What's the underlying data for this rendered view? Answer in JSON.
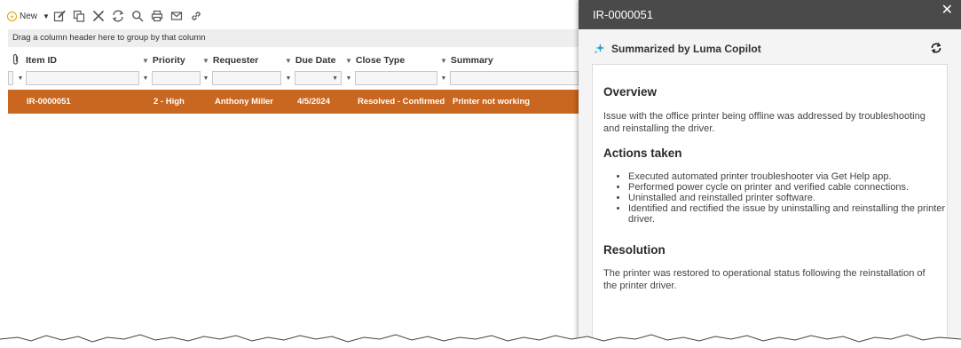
{
  "toolbar": {
    "new_label": "New",
    "icons": [
      "edit-icon",
      "copy-icon",
      "delete-icon",
      "refresh-icon",
      "search-icon",
      "print-icon",
      "email-icon",
      "link-icon"
    ]
  },
  "grid": {
    "group_hint": "Drag a column header here to group by that column",
    "columns": [
      "Item ID",
      "Priority",
      "Requester",
      "Due Date",
      "Close Type",
      "Summary"
    ],
    "rows": [
      {
        "item_id": "IR-0000051",
        "priority": "2 - High",
        "requester": "Anthony Miller",
        "due_date": "4/5/2024",
        "close_type": "Resolved - Confirmed",
        "summary": "Printer not working"
      }
    ],
    "selected_row_color": "#c9661f"
  },
  "panel": {
    "title": "IR-0000051",
    "close_symbol": "✕",
    "copilot_label": "Summarized by Luma Copilot",
    "sections": {
      "overview_heading": "Overview",
      "overview_text": "Issue with the office printer being offline was addressed by troubleshooting and reinstalling the driver.",
      "actions_heading": "Actions taken",
      "actions": [
        "Executed automated printer troubleshooter via Get Help app.",
        "Performed power cycle on printer and verified cable connections.",
        "Uninstalled and reinstalled printer software.",
        "Identified and rectified the issue by uninstalling and reinstalling the printer driver."
      ],
      "resolution_heading": "Resolution",
      "resolution_text": "The printer was restored to operational status following the reinstallation of the printer driver."
    },
    "accent_color": "#1fa3c9"
  }
}
